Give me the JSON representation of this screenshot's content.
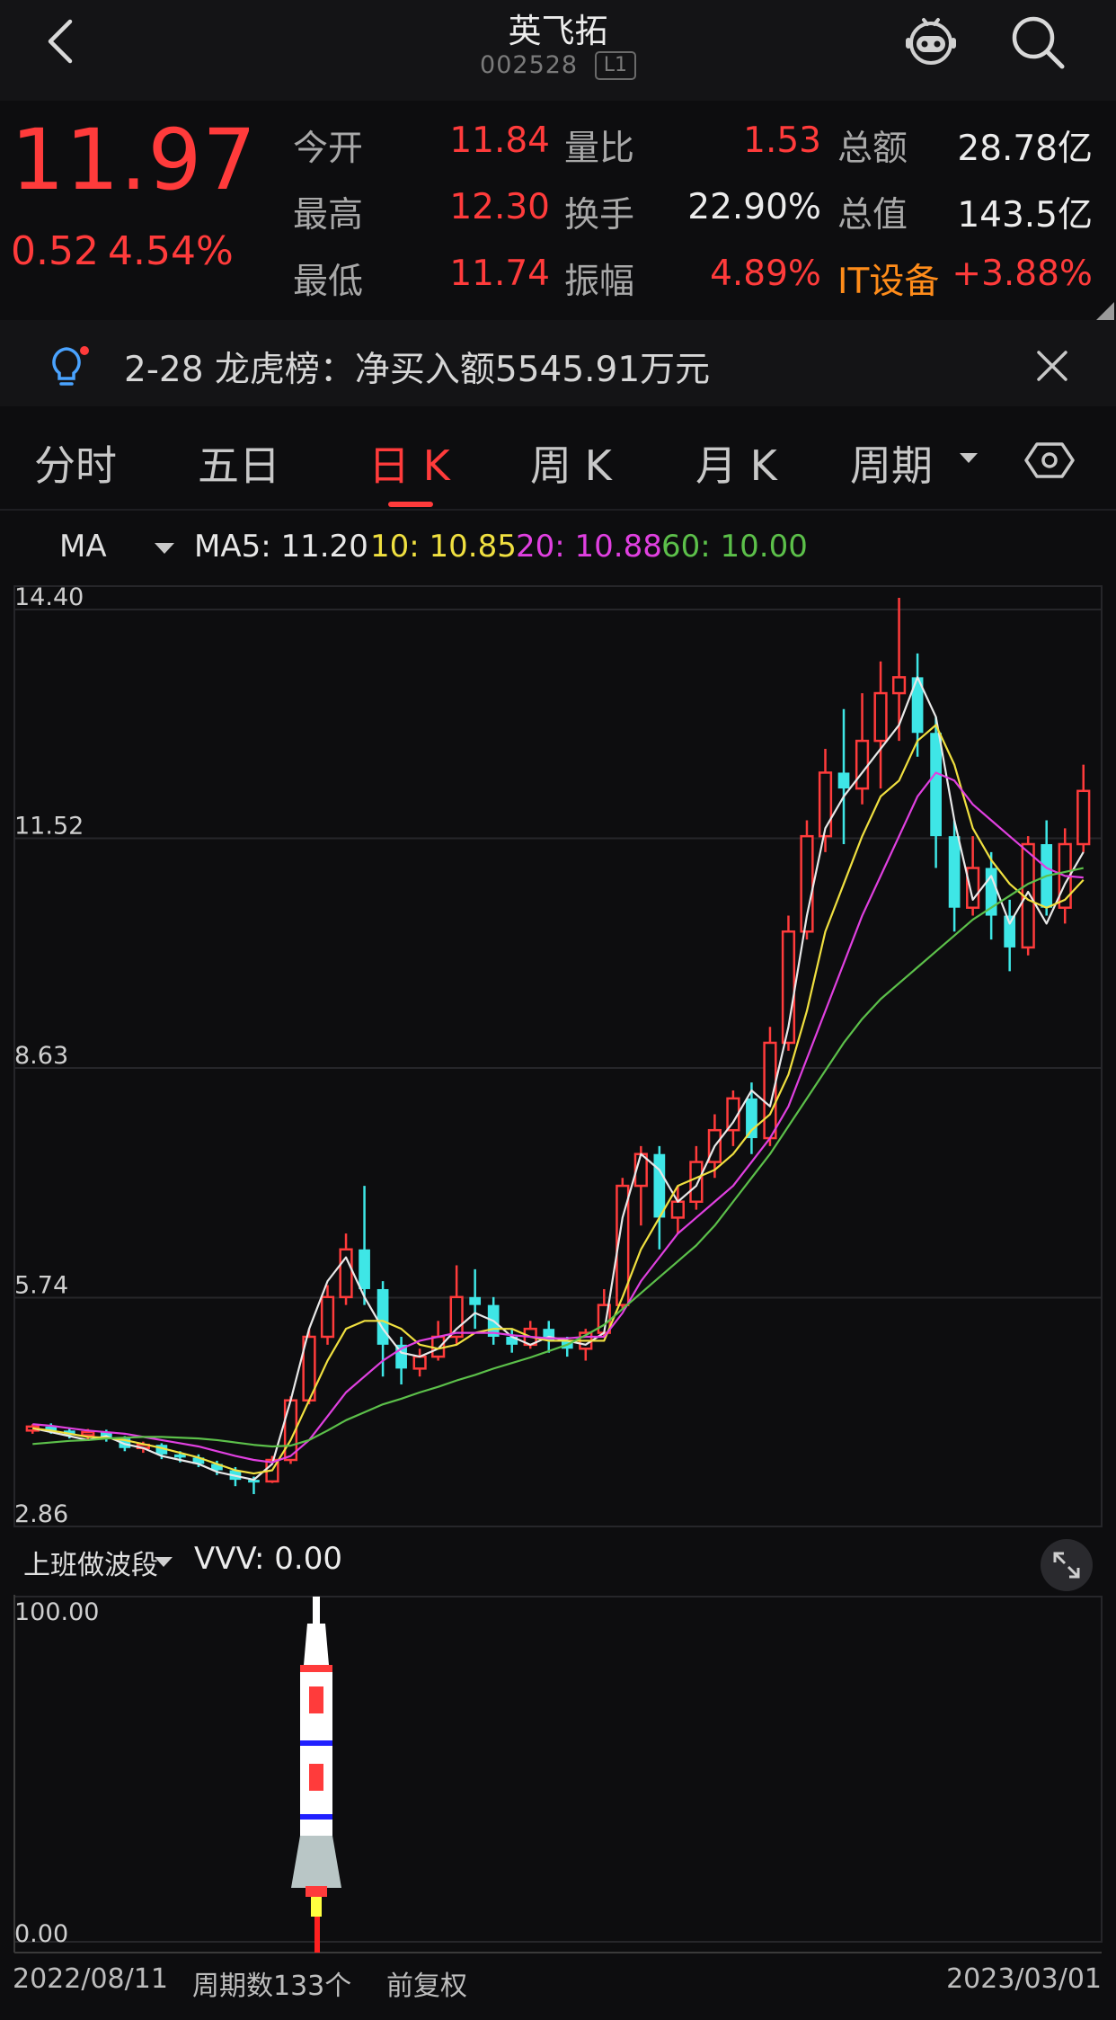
{
  "header": {
    "title": "英飞拓",
    "code": "002528",
    "level_badge": "L1"
  },
  "quote": {
    "price": "11.97",
    "change": "0.52",
    "change_pct": "4.54%",
    "rows": [
      {
        "l1": "今开",
        "v1": "11.84",
        "l2": "量比",
        "v2": "1.53",
        "l3": "总额",
        "v3": "28.78亿"
      },
      {
        "l1": "最高",
        "v1": "12.30",
        "l2": "换手",
        "v2": "22.90%",
        "l3": "总值",
        "v3": "143.5亿"
      },
      {
        "l1": "最低",
        "v1": "11.74",
        "l2": "振幅",
        "v2": "4.89%",
        "l3": "IT设备",
        "v3": "+3.88%"
      }
    ]
  },
  "notice": {
    "text": "2-28 龙虎榜：净买入额5545.91万元"
  },
  "tabs": [
    "分时",
    "五日",
    "日 K",
    "周 K",
    "月 K",
    "周期"
  ],
  "active_tab": "日 K",
  "ma_legend": {
    "label": "MA",
    "items": [
      {
        "text": "MA5: 11.20",
        "color": "#e8e8e8"
      },
      {
        "text": "10: 10.85",
        "color": "#f0e040"
      },
      {
        "text": "20: 10.88",
        "color": "#e040e0"
      },
      {
        "text": "60: 10.00",
        "color": "#5cc04a"
      }
    ]
  },
  "price_axis_labels": [
    "14.40",
    "11.52",
    "8.63",
    "5.74",
    "2.86"
  ],
  "sub_indicator": {
    "name": "上班做波段",
    "value": "VVV: 0.00",
    "axis_top": "100.00",
    "axis_bottom": "0.00"
  },
  "footer": {
    "date_start": "2022/08/11",
    "periods": "周期数133个",
    "adjust": "前复权",
    "date_end": "2023/03/01"
  },
  "colors": {
    "up": "#ff3b3b",
    "down": "#3ee6e6",
    "accent": "#ff3b3b",
    "sector": "#ff8c1a"
  },
  "chart_data": {
    "type": "candlestick",
    "ylim": [
      2.86,
      14.4
    ],
    "x_range": [
      "2022/08/11",
      "2023/03/01"
    ],
    "series": [
      {
        "name": "MA5",
        "color": "#e8e8e8",
        "values": [
          3.95,
          3.9,
          3.85,
          3.8,
          3.85,
          3.75,
          3.7,
          3.6,
          3.55,
          3.5,
          3.4,
          3.35,
          3.3,
          3.5,
          4.3,
          5.2,
          5.8,
          6.1,
          5.6,
          5.2,
          4.9,
          4.85,
          4.95,
          5.2,
          5.4,
          5.3,
          5.1,
          5.0,
          5.1,
          5.05,
          5.0,
          5.15,
          6.6,
          7.4,
          7.2,
          6.8,
          7.0,
          7.5,
          7.8,
          8.2,
          8.0,
          9.0,
          10.4,
          11.5,
          11.9,
          12.2,
          12.5,
          12.8,
          13.4,
          12.9,
          11.6,
          10.6,
          10.9,
          10.3,
          10.7,
          10.3,
          10.8,
          11.2
        ]
      },
      {
        "name": "MA10",
        "color": "#f0e040",
        "values": [
          3.95,
          3.92,
          3.88,
          3.84,
          3.83,
          3.8,
          3.75,
          3.7,
          3.64,
          3.58,
          3.5,
          3.42,
          3.38,
          3.42,
          3.8,
          4.3,
          4.8,
          5.2,
          5.3,
          5.3,
          5.2,
          5.0,
          4.95,
          5.0,
          5.15,
          5.2,
          5.2,
          5.1,
          5.05,
          5.05,
          5.05,
          5.05,
          5.6,
          6.2,
          6.6,
          7.0,
          7.1,
          7.2,
          7.4,
          7.7,
          7.9,
          8.4,
          9.2,
          10.2,
          10.8,
          11.4,
          11.9,
          12.1,
          12.6,
          12.8,
          12.3,
          11.5,
          11.1,
          10.8,
          10.6,
          10.5,
          10.6,
          10.85
        ]
      },
      {
        "name": "MA20",
        "color": "#e040e0",
        "values": [
          4.0,
          3.98,
          3.95,
          3.92,
          3.9,
          3.88,
          3.84,
          3.8,
          3.76,
          3.72,
          3.66,
          3.6,
          3.55,
          3.52,
          3.6,
          3.8,
          4.1,
          4.4,
          4.6,
          4.8,
          4.95,
          5.05,
          5.1,
          5.15,
          5.15,
          5.15,
          5.12,
          5.1,
          5.08,
          5.08,
          5.1,
          5.1,
          5.4,
          5.8,
          6.1,
          6.4,
          6.6,
          6.8,
          7.0,
          7.3,
          7.6,
          8.0,
          8.6,
          9.2,
          9.8,
          10.4,
          10.9,
          11.4,
          11.9,
          12.2,
          12.1,
          11.8,
          11.6,
          11.4,
          11.2,
          11.0,
          10.9,
          10.88
        ]
      },
      {
        "name": "MA60",
        "color": "#5cc04a",
        "values": [
          3.75,
          3.77,
          3.79,
          3.8,
          3.82,
          3.83,
          3.84,
          3.84,
          3.83,
          3.82,
          3.8,
          3.77,
          3.74,
          3.72,
          3.73,
          3.8,
          3.92,
          4.05,
          4.15,
          4.25,
          4.32,
          4.4,
          4.47,
          4.55,
          4.62,
          4.7,
          4.77,
          4.84,
          4.92,
          5.0,
          5.12,
          5.25,
          5.45,
          5.65,
          5.85,
          6.05,
          6.25,
          6.5,
          6.8,
          7.1,
          7.4,
          7.75,
          8.1,
          8.45,
          8.8,
          9.1,
          9.35,
          9.55,
          9.75,
          9.95,
          10.15,
          10.35,
          10.5,
          10.65,
          10.8,
          10.9,
          10.95,
          11.0
        ]
      }
    ],
    "candles": [
      [
        3.92,
        3.97,
        3.88,
        4.0
      ],
      [
        3.97,
        3.92,
        3.88,
        4.01
      ],
      [
        3.92,
        3.86,
        3.82,
        3.95
      ],
      [
        3.86,
        3.9,
        3.8,
        3.94
      ],
      [
        3.9,
        3.82,
        3.78,
        3.93
      ],
      [
        3.82,
        3.7,
        3.66,
        3.85
      ],
      [
        3.7,
        3.74,
        3.64,
        3.78
      ],
      [
        3.74,
        3.62,
        3.56,
        3.76
      ],
      [
        3.62,
        3.58,
        3.52,
        3.66
      ],
      [
        3.58,
        3.5,
        3.46,
        3.62
      ],
      [
        3.5,
        3.42,
        3.36,
        3.54
      ],
      [
        3.42,
        3.3,
        3.22,
        3.46
      ],
      [
        3.3,
        3.28,
        3.12,
        3.34
      ],
      [
        3.28,
        3.55,
        3.26,
        3.6
      ],
      [
        3.55,
        4.3,
        3.5,
        4.35
      ],
      [
        4.3,
        5.1,
        4.25,
        5.2
      ],
      [
        5.1,
        5.6,
        5.0,
        5.75
      ],
      [
        5.6,
        6.2,
        5.5,
        6.4
      ],
      [
        6.2,
        5.7,
        5.5,
        7.0
      ],
      [
        5.7,
        5.0,
        4.6,
        5.8
      ],
      [
        5.0,
        4.7,
        4.5,
        5.1
      ],
      [
        4.7,
        4.85,
        4.6,
        4.95
      ],
      [
        4.85,
        5.1,
        4.8,
        5.3
      ],
      [
        5.1,
        5.6,
        5.0,
        6.0
      ],
      [
        5.6,
        5.5,
        5.2,
        5.95
      ],
      [
        5.5,
        5.1,
        5.0,
        5.6
      ],
      [
        5.1,
        5.0,
        4.9,
        5.2
      ],
      [
        5.0,
        5.2,
        4.95,
        5.3
      ],
      [
        5.2,
        5.05,
        4.9,
        5.3
      ],
      [
        5.05,
        4.95,
        4.85,
        5.1
      ],
      [
        4.95,
        5.15,
        4.8,
        5.2
      ],
      [
        5.15,
        5.5,
        5.1,
        5.7
      ],
      [
        5.5,
        7.0,
        5.45,
        7.1
      ],
      [
        7.0,
        7.4,
        6.5,
        7.5
      ],
      [
        7.4,
        6.6,
        6.2,
        7.5
      ],
      [
        6.6,
        6.8,
        6.4,
        7.0
      ],
      [
        6.8,
        7.3,
        6.7,
        7.5
      ],
      [
        7.3,
        7.7,
        7.1,
        7.9
      ],
      [
        7.7,
        8.1,
        7.5,
        8.2
      ],
      [
        8.1,
        7.6,
        7.4,
        8.3
      ],
      [
        7.6,
        8.8,
        7.5,
        9.0
      ],
      [
        8.8,
        10.2,
        8.7,
        10.4
      ],
      [
        10.2,
        11.4,
        10.1,
        11.6
      ],
      [
        11.4,
        12.2,
        11.2,
        12.5
      ],
      [
        12.2,
        12.0,
        11.3,
        13.0
      ],
      [
        12.0,
        12.6,
        11.8,
        13.2
      ],
      [
        12.6,
        13.2,
        12.0,
        13.6
      ],
      [
        13.2,
        13.4,
        12.6,
        14.4
      ],
      [
        13.4,
        12.7,
        12.4,
        13.7
      ],
      [
        12.7,
        11.4,
        11.0,
        12.9
      ],
      [
        11.4,
        10.5,
        10.2,
        11.6
      ],
      [
        10.5,
        11.0,
        10.4,
        11.4
      ],
      [
        11.0,
        10.4,
        10.1,
        11.2
      ],
      [
        10.4,
        10.0,
        9.7,
        10.6
      ],
      [
        10.0,
        11.3,
        9.9,
        11.4
      ],
      [
        11.3,
        10.5,
        10.4,
        11.6
      ],
      [
        10.5,
        11.3,
        10.3,
        11.5
      ],
      [
        11.3,
        11.97,
        11.2,
        12.3
      ]
    ]
  }
}
